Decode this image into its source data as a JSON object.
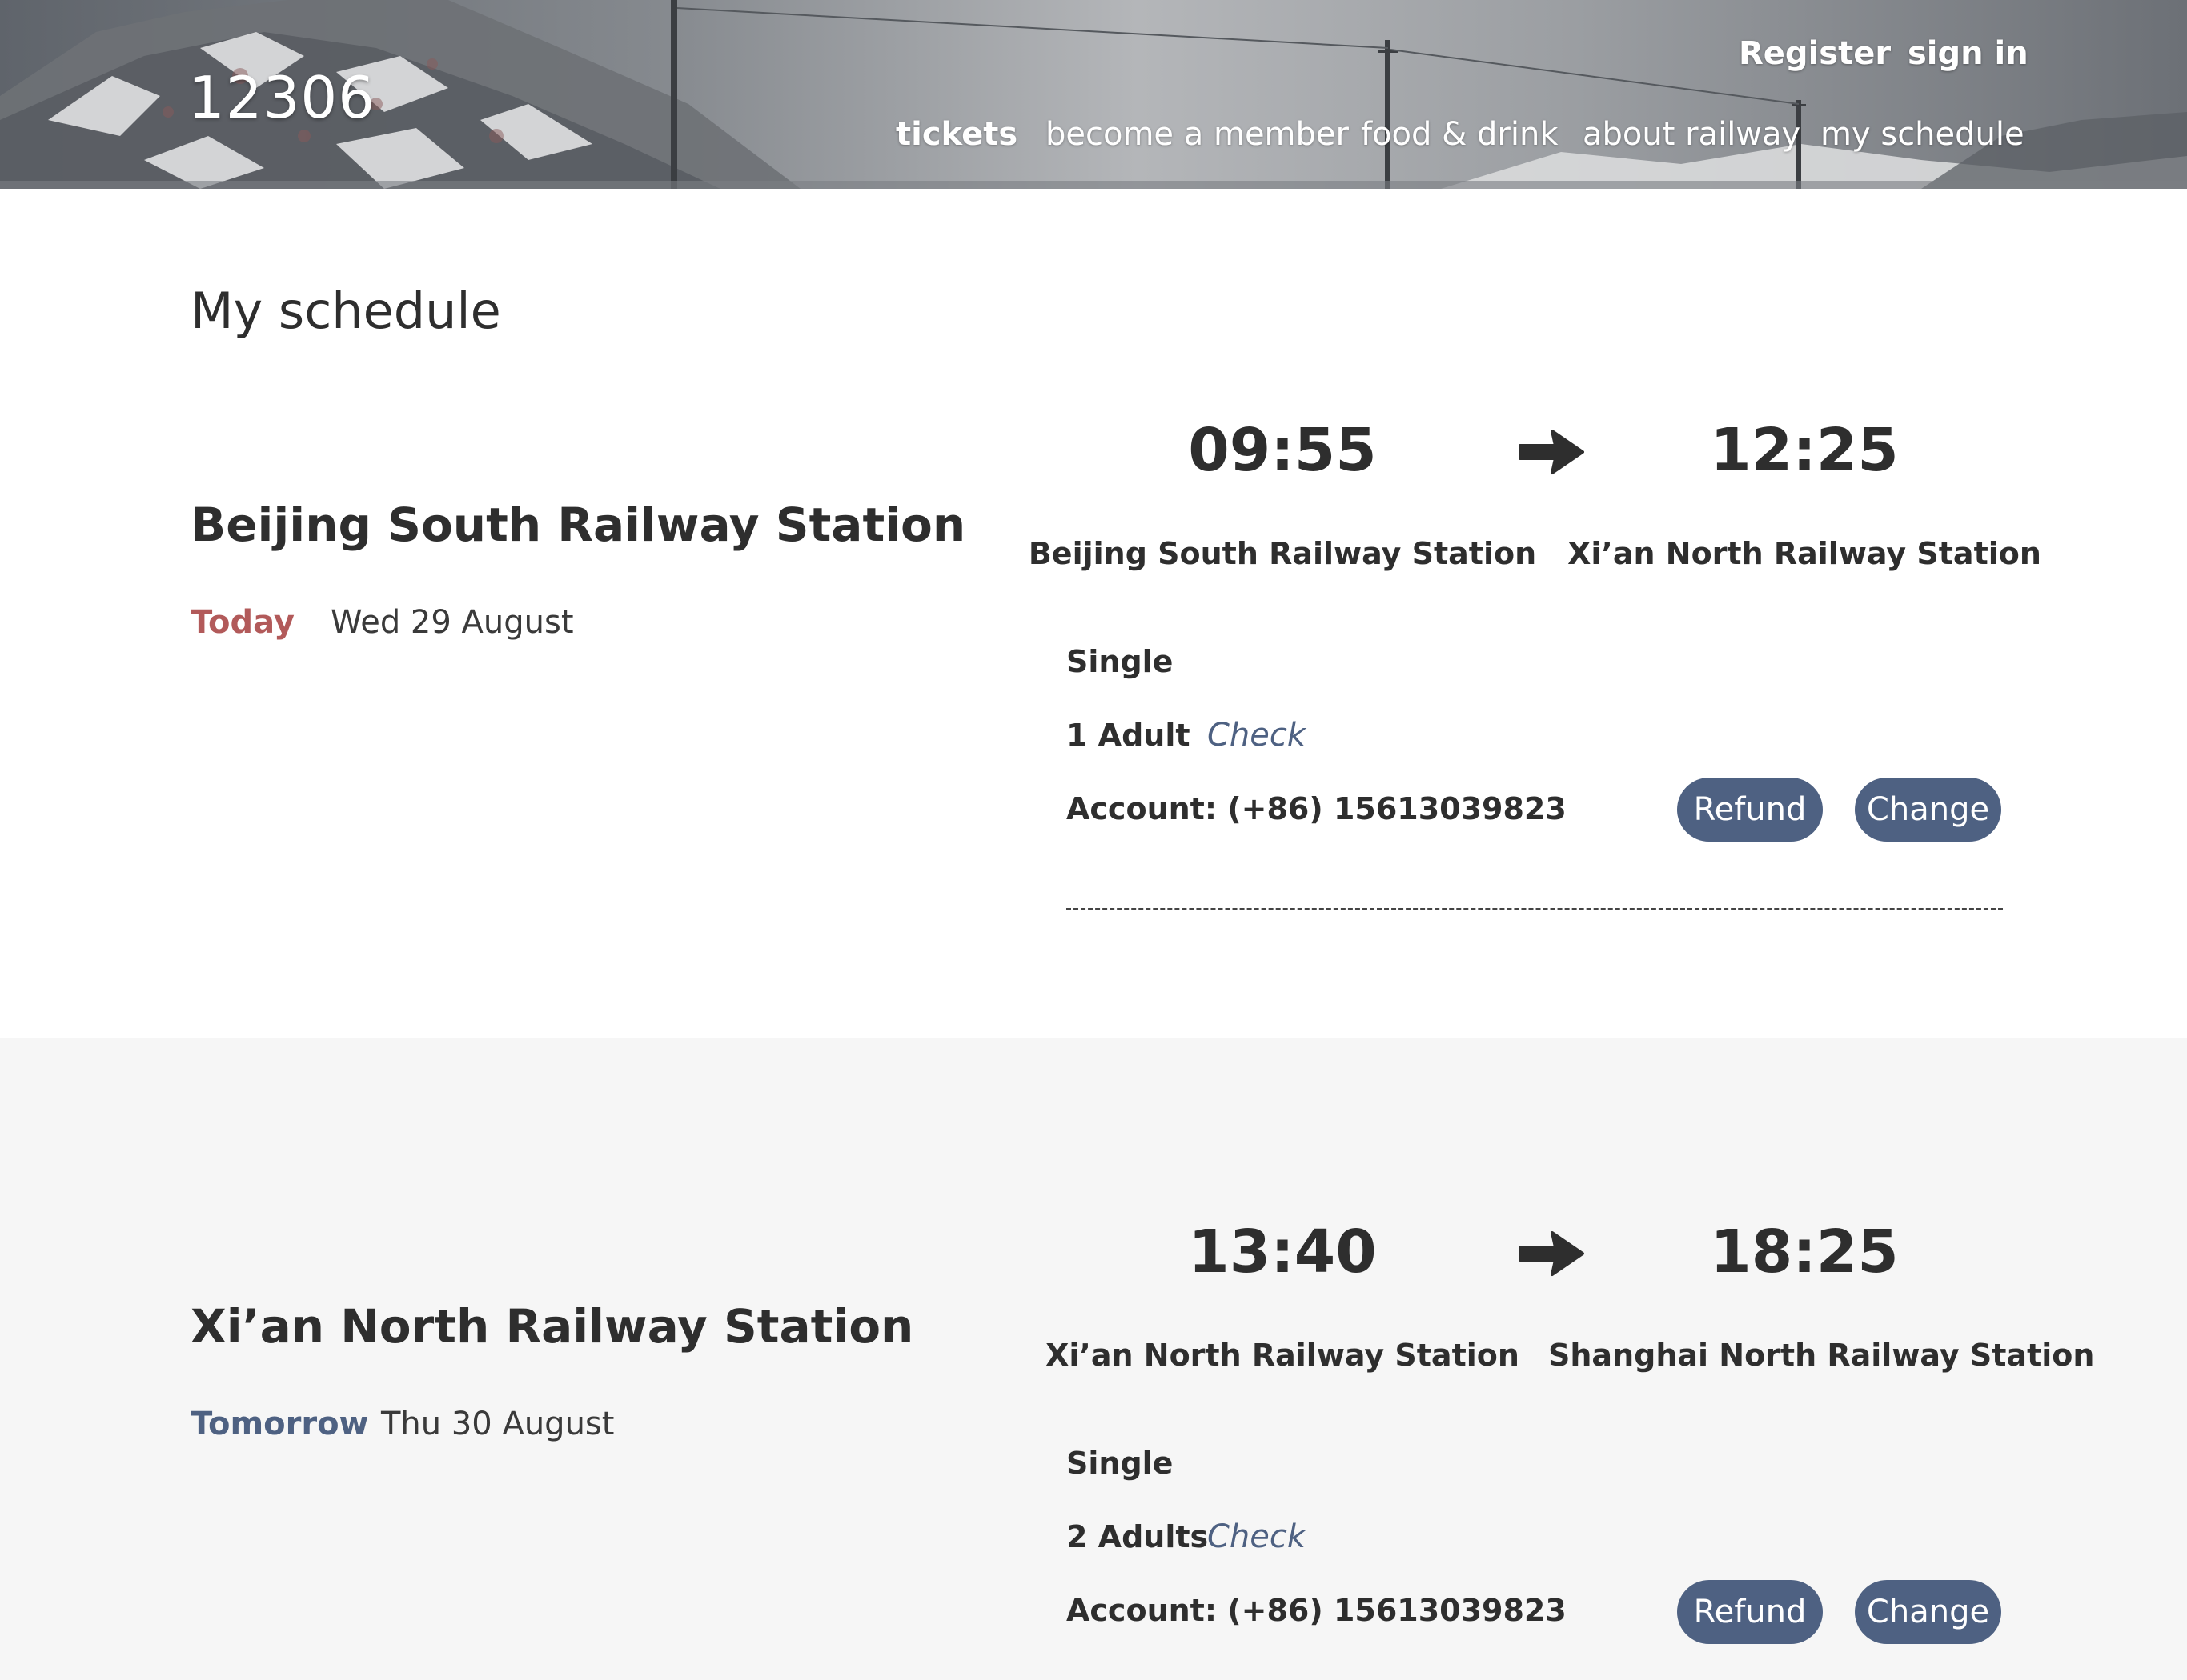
{
  "header": {
    "logo": "12306",
    "auth": {
      "register": "Register",
      "sign_in": "sign in"
    },
    "nav": [
      {
        "label": "tickets",
        "active": true
      },
      {
        "label": "become a member",
        "active": false
      },
      {
        "label": "food & drink",
        "active": false
      },
      {
        "label": "about railway",
        "active": false
      },
      {
        "label": "my schedule",
        "active": false
      }
    ]
  },
  "page_title": "My schedule",
  "trips": [
    {
      "origin_title": "Beijing South Railway Station",
      "day_label": "Today",
      "date": "Wed 29 August",
      "depart_time": "09:55",
      "arrive_time": "12:25",
      "from_station": "Beijing South Railway Station",
      "to_station": "Xi’an North Railway Station",
      "ticket_type": "Single",
      "passengers": "1 Adult",
      "check_label": "Check",
      "account": "Account: (+86) 15613039823",
      "refund_label": "Refund",
      "change_label": "Change"
    },
    {
      "origin_title": "Xi’an North Railway Station",
      "day_label": "Tomorrow",
      "date": "Thu 30 August",
      "depart_time": "13:40",
      "arrive_time": "18:25",
      "from_station": "Xi’an North Railway Station",
      "to_station": "Shanghai North Railway Station",
      "ticket_type": "Single",
      "passengers": "2 Adults",
      "check_label": "Check",
      "account": "Account: (+86) 15613039823",
      "refund_label": "Refund",
      "change_label": "Change"
    }
  ],
  "icons": {
    "arrow": "arrow-right-icon"
  },
  "colors": {
    "accent": "#4e6182",
    "today": "#b25a5a",
    "text": "#2e2e2e",
    "gray_section": "#f6f6f6"
  }
}
